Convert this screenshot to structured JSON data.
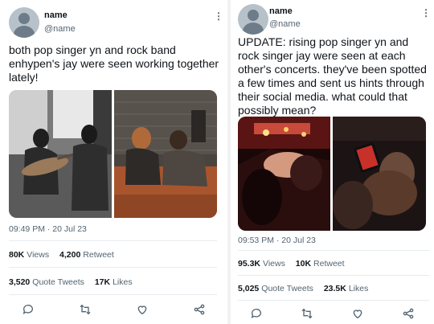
{
  "left_tweet": {
    "name": "name",
    "handle": "@name",
    "text": "both pop singer yn and rock band enhypen's jay were seen working together lately!",
    "timestamp": "09:49 PM · 20 Jul 23",
    "views_count": "80K",
    "views_label": "Views",
    "retweets_count": "4,200",
    "retweets_label": "Retweet",
    "quotes_count": "3,520",
    "quotes_label": "Quote Tweets",
    "likes_count": "17K",
    "likes_label": "Likes"
  },
  "right_tweet": {
    "name": "name",
    "handle": "@name",
    "text": "UPDATE: rising pop singer yn and rock singer jay were seen at each other's concerts. they've been spotted a few times and sent us hints through their social media. what could that possibly mean?",
    "timestamp": "09:53 PM · 20 Jul 23",
    "views_count": "95.3K",
    "views_label": "Views",
    "retweets_count": "10K",
    "retweets_label": "Retweet",
    "quotes_count": "5,025",
    "quotes_label": "Quote Tweets",
    "likes_count": "23.5K",
    "likes_label": "Likes"
  },
  "icons": [
    "more-icon",
    "reply-icon",
    "retweet-icon",
    "like-icon",
    "share-icon"
  ],
  "colors": {
    "text": "#0f1419",
    "secondary": "#536471",
    "divider": "#e6ecf0"
  }
}
